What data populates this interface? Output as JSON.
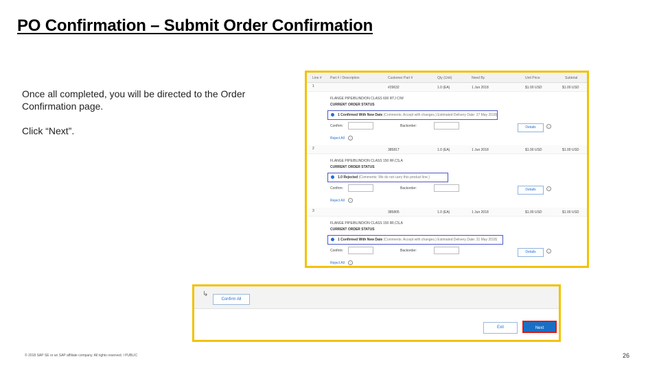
{
  "slide": {
    "title": "PO Confirmation – Submit Order Confirmation",
    "paragraphs": [
      "Once all completed, you will be directed to the  Order Confirmation page.",
      "Click “Next”."
    ],
    "footer": "© 2018 SAP SE or an SAP affiliate company. All rights reserved.  ǀ  PUBLIC",
    "page_number": "26"
  },
  "order_table": {
    "headers": [
      "Line #",
      "Part # / Description",
      "Customer Part #",
      "Qty (Unit)",
      "Need By",
      "Unit Price",
      "Subtotal"
    ],
    "current_status_label": "CURRENT ORDER STATUS",
    "confirm_label": "Confirm:",
    "backorder_label": "Backorder:",
    "details_label": "Details",
    "reject_all_label": "Reject All",
    "lines": [
      {
        "line": "1",
        "customer_part": "#29632",
        "qty": "1.0 (EA)",
        "need_by": "1 Jun 2018",
        "unit_price": "$1.00 USD",
        "subtotal": "$1.00 USD",
        "description": "FLANGE PIPE/BLIND/ON CLASS 600 RTJ C/W",
        "status": "1 Confirmed With New Date",
        "status_note": "(Comments: Accept with changes.) Estimated Delivery Date: 27 May 2018)"
      },
      {
        "line": "2",
        "customer_part": "385817",
        "qty": "1.0 (EA)",
        "need_by": "1 Jun 2018",
        "unit_price": "$1.00 USD",
        "subtotal": "$1.00 USD",
        "description": "FLANGE PIPE/BLIND/ON CLASS 150 RF,CS,A",
        "status": "1.0 Rejected",
        "status_note": "(Comments: We do not carry this product line.)"
      },
      {
        "line": "3",
        "customer_part": "385805",
        "qty": "1.0 (EA)",
        "need_by": "1 Jun 2018",
        "unit_price": "$1.00 USD",
        "subtotal": "$1.00 USD",
        "description": "FLANGE PIPE/BLIND/ON CLASS 150 RF,CS,A",
        "status": "1 Confirmed With New Date",
        "status_note": "(Comments: Accept with changes.) Estimated Delivery Date: 31 May 2018)"
      }
    ]
  },
  "actions": {
    "confirm_all_label": "Confirm All",
    "exit_label": "Exit",
    "next_label": "Next",
    "arrow_glyph": "↳"
  },
  "colors": {
    "highlight_border": "#f2c200",
    "status_outline": "#4a57c2",
    "next_outline": "#d51c1c",
    "primary_blue": "#1a6fc4"
  }
}
